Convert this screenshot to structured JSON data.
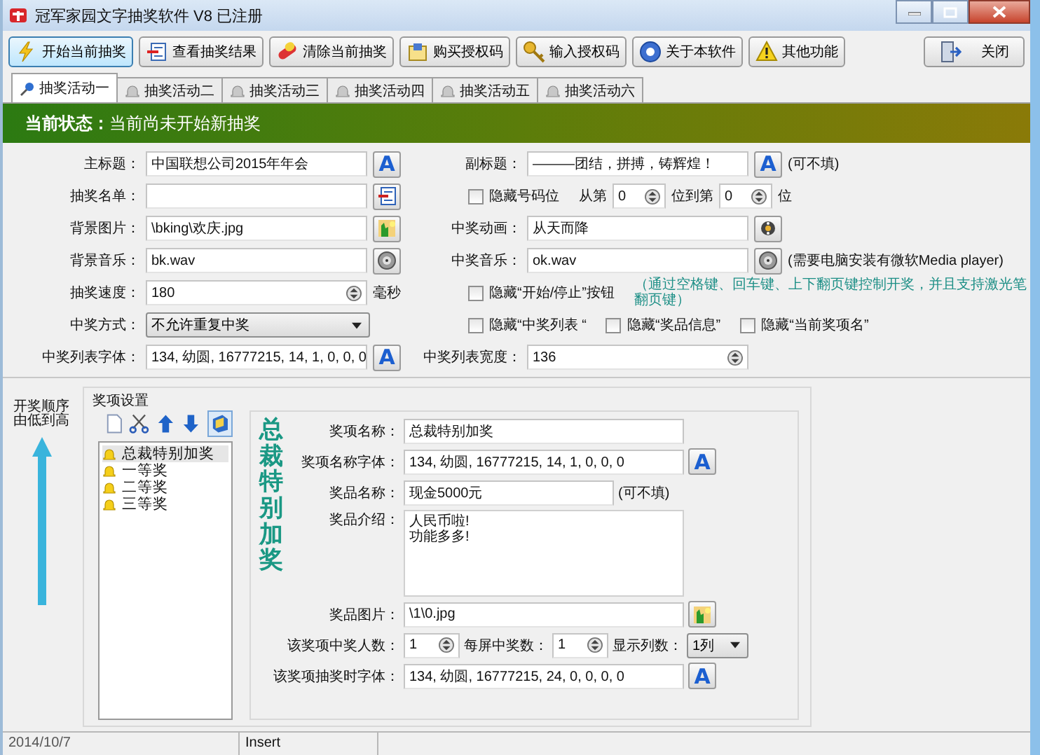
{
  "window": {
    "title": "冠军家园文字抽奖软件  V8 已注册"
  },
  "toolbar": [
    {
      "label": "开始当前抽奖",
      "focused": true
    },
    {
      "label": "查看抽奖结果",
      "focused": false
    },
    {
      "label": "清除当前抽奖",
      "focused": false
    },
    {
      "label": "购买授权码",
      "focused": false
    },
    {
      "label": "输入授权码",
      "focused": false
    },
    {
      "label": "关于本软件",
      "focused": false
    },
    {
      "label": "其他功能",
      "focused": false
    }
  ],
  "close_button": "关闭",
  "tabs": [
    {
      "label": "抽奖活动一",
      "selected": true
    },
    {
      "label": "抽奖活动二",
      "selected": false
    },
    {
      "label": "抽奖活动三",
      "selected": false
    },
    {
      "label": "抽奖活动四",
      "selected": false
    },
    {
      "label": "抽奖活动五",
      "selected": false
    },
    {
      "label": "抽奖活动六",
      "selected": false
    }
  ],
  "status": {
    "label": "当前状态：",
    "value": "当前尚未开始新抽奖"
  },
  "settings": [
    {
      "left": {
        "kind": "text",
        "label": "主标题：",
        "value": "中国联想公司2015年年会",
        "button": {
          "kind": "font",
          "text": "A"
        }
      },
      "right": {
        "kind": "text",
        "label": "副标题：",
        "value": "———团结，拼搏，铸辉煌！",
        "button": {
          "kind": "font",
          "text": "A"
        },
        "note": "(可不填)"
      }
    },
    {
      "left": {
        "kind": "text",
        "label": "抽奖名单：",
        "button": {
          "kind": "list"
        }
      },
      "right": {
        "kind": "digits",
        "items": [
          {
            "label": "隐藏号码位",
            "checked": false
          }
        ],
        "from_label": "从第",
        "from": "0",
        "mid_label": "位到第",
        "to": "0",
        "end_label": "位"
      }
    },
    {
      "left": {
        "kind": "text",
        "label": "背景图片：",
        "value": "\\bking\\欢庆.jpg",
        "button": {
          "kind": "image"
        }
      },
      "right": {
        "kind": "text",
        "label": "中奖动画：",
        "value": "从天而降",
        "button": {
          "kind": "film"
        }
      }
    },
    {
      "left": {
        "kind": "text",
        "label": "背景音乐：",
        "value": "bk.wav",
        "button": {
          "kind": "sound"
        }
      },
      "right": {
        "kind": "text",
        "label": "中奖音乐：",
        "value": "ok.wav",
        "button": {
          "kind": "sound"
        },
        "note": "(需要电脑安装有微软Media player)"
      }
    },
    {
      "left": {
        "kind": "spin",
        "label": "抽奖速度：",
        "value": "180",
        "unit": "毫秒"
      },
      "right": {
        "kind": "checks",
        "items": [
          {
            "label": "隐藏“开始/停止”按钮",
            "checked": false
          }
        ],
        "note": "（通过空格键、回车键、上下翻页键控制开奖，并且支持激光笔翻页键）"
      }
    },
    {
      "left": {
        "kind": "select",
        "label": "中奖方式：",
        "value": "不允许重复中奖"
      },
      "right": {
        "kind": "checks",
        "items": [
          {
            "label": "隐藏“中奖列表 “",
            "checked": false
          },
          {
            "label": "隐藏“奖品信息”",
            "checked": false
          },
          {
            "label": "隐藏“当前奖项名”",
            "checked": false
          }
        ]
      }
    },
    {
      "left": {
        "kind": "text",
        "label": "中奖列表字体：",
        "value": "134, 幼圆, 16777215, 14, 1, 0, 0, 0",
        "button": {
          "kind": "font",
          "text": "A"
        }
      },
      "right": {
        "kind": "spin",
        "label": "中奖列表宽度：",
        "value": "136"
      }
    }
  ],
  "order_hint": [
    "开奖顺序",
    "由低到高"
  ],
  "prize_settings": {
    "title": "奖项设置",
    "items": [
      {
        "label": "总裁特别加奖",
        "selected": true
      },
      {
        "label": "一等奖",
        "selected": false
      },
      {
        "label": "二等奖",
        "selected": false
      },
      {
        "label": "三等奖",
        "selected": false
      }
    ],
    "heading": "总裁特别加奖",
    "fields": [
      {
        "kind": "text",
        "label": "奖项名称：",
        "value": "总裁特别加奖"
      },
      {
        "kind": "text",
        "label": "奖项名称字体：",
        "value": "134, 幼圆, 16777215, 14, 1, 0, 0, 0",
        "button": {
          "kind": "font",
          "text": "A"
        }
      },
      {
        "kind": "text",
        "label": "奖品名称：",
        "value": "现金5000元",
        "note": "(可不填)"
      },
      {
        "kind": "memo",
        "label": "奖品介绍：",
        "lines": [
          "人民币啦!",
          "功能多多!"
        ]
      },
      {
        "kind": "text",
        "label": "奖品图片：",
        "value": "\\1\\0.jpg",
        "button": {
          "kind": "image"
        }
      },
      {
        "kind": "counts",
        "label": "该奖项中奖人数：",
        "value": "1",
        "per_screen_label": "每屏中奖数：",
        "per_screen": "1",
        "columns_label": "显示列数：",
        "columns": "1列"
      },
      {
        "kind": "text",
        "label": "该奖项抽奖时字体：",
        "value": "134, 幼圆, 16777215, 24, 0, 0, 0, 0",
        "button": {
          "kind": "font",
          "text": "A"
        }
      }
    ]
  },
  "status_bar": [
    "2014/10/7",
    "Insert"
  ]
}
